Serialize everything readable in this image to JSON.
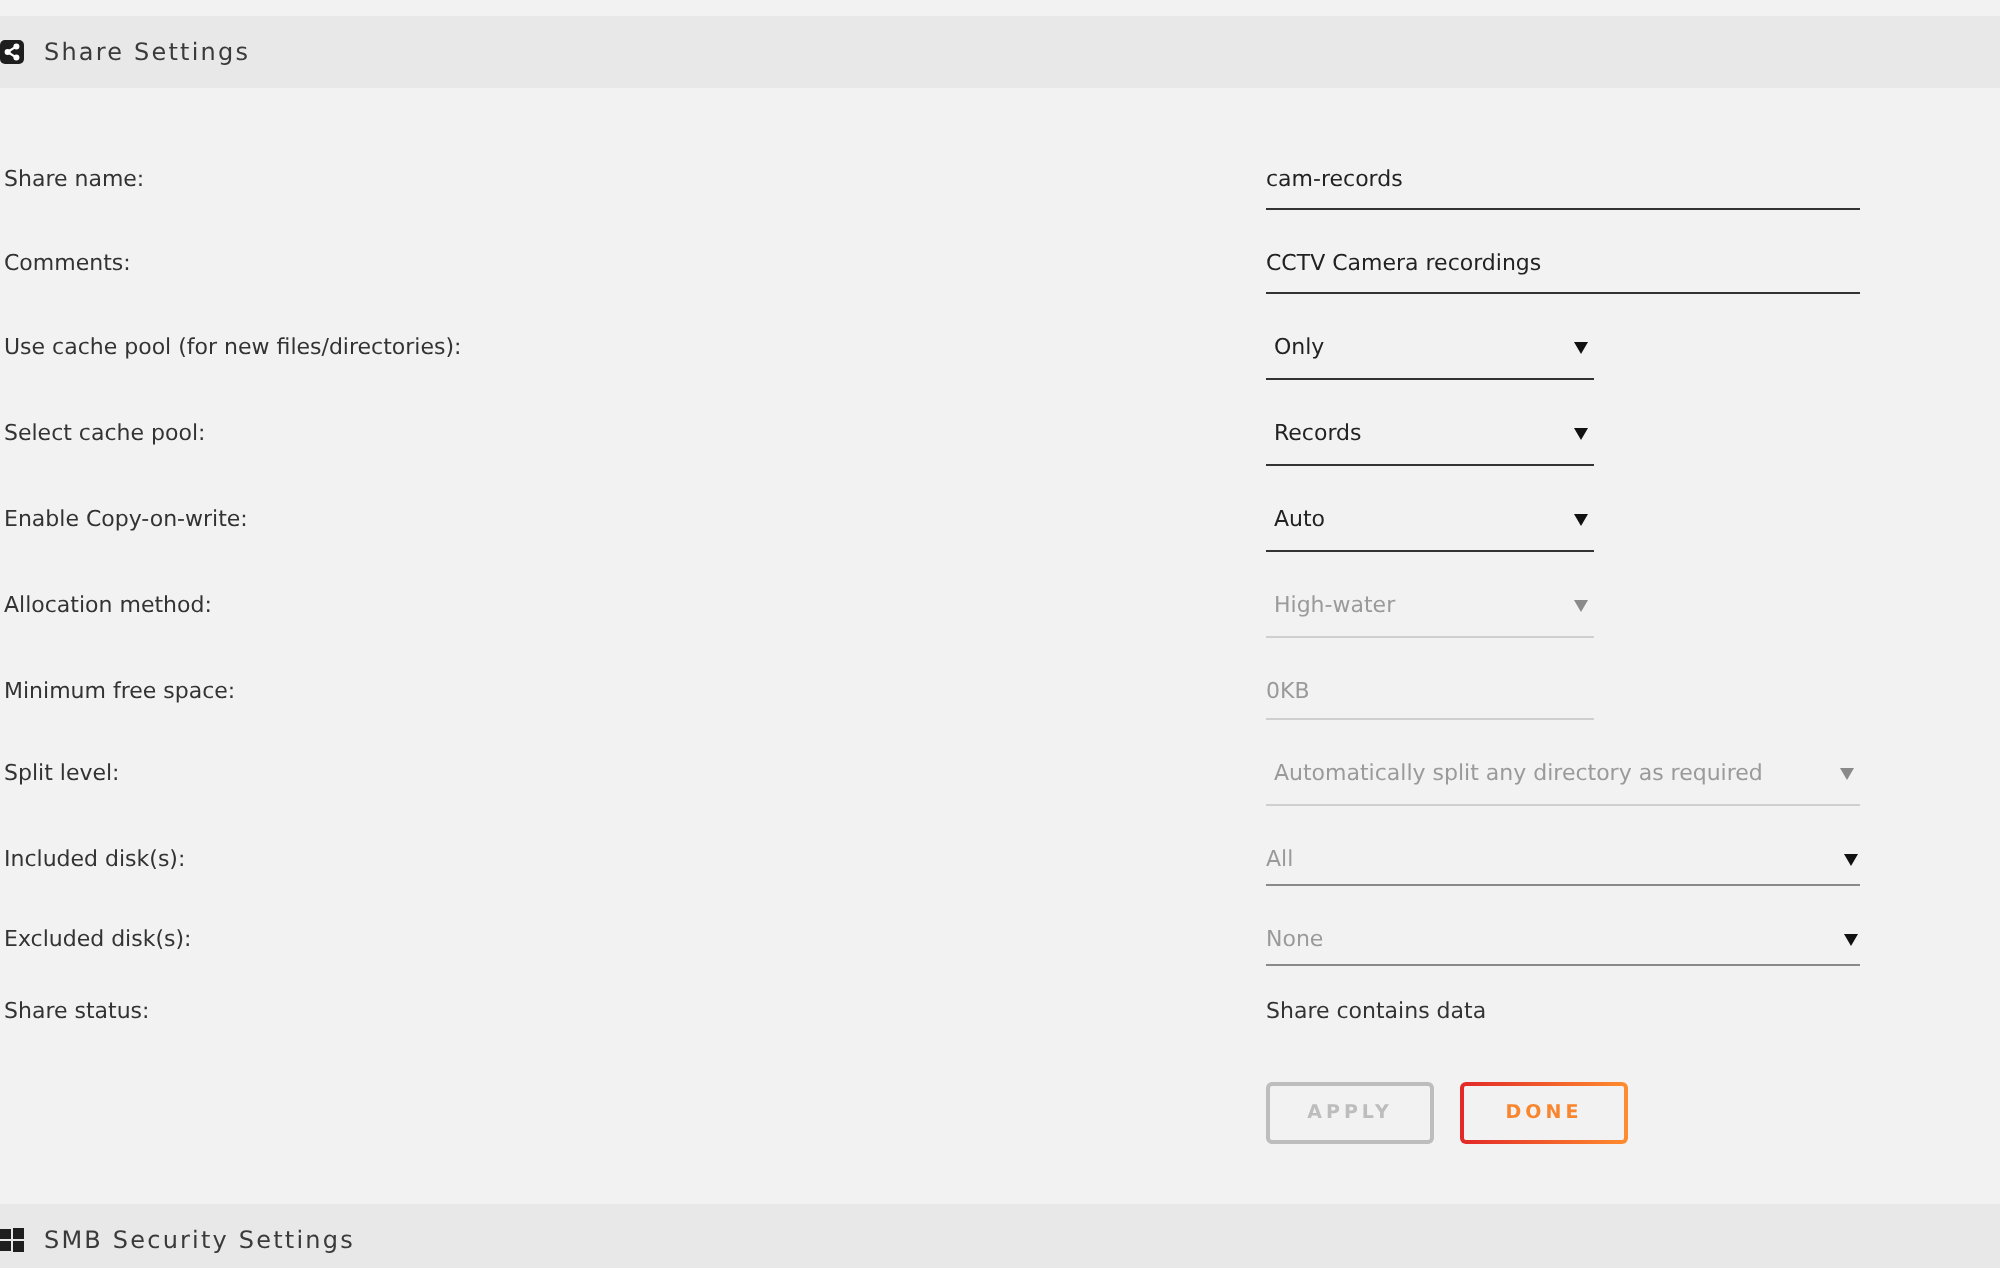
{
  "share_settings": {
    "title": "Share Settings",
    "fields": [
      {
        "label": "Share name:",
        "kind": "text",
        "value": "cam-records",
        "disabled": false
      },
      {
        "label": "Comments:",
        "kind": "text",
        "value": "CCTV Camera recordings",
        "disabled": false
      },
      {
        "label": "Use cache pool (for new files/directories):",
        "kind": "select",
        "value": "Only",
        "disabled": false
      },
      {
        "label": "Select cache pool:",
        "kind": "select",
        "value": "Records",
        "disabled": false
      },
      {
        "label": "Enable Copy-on-write:",
        "kind": "select",
        "value": "Auto",
        "disabled": false
      },
      {
        "label": "Allocation method:",
        "kind": "select",
        "value": "High-water",
        "disabled": true
      },
      {
        "label": "Minimum free space:",
        "kind": "sizeinput",
        "value": "0KB",
        "disabled": true
      },
      {
        "label": "Split level:",
        "kind": "longselect",
        "value": "Automatically split any directory as required",
        "disabled": true
      },
      {
        "label": "Included disk(s):",
        "kind": "disklist",
        "value": "All",
        "disabled": false
      },
      {
        "label": "Excluded disk(s):",
        "kind": "disklist",
        "value": "None",
        "disabled": false
      },
      {
        "label": "Share status:",
        "kind": "status",
        "value": "Share contains data",
        "disabled": false
      }
    ],
    "buttons": [
      {
        "label": "APPLY",
        "disabled": true
      },
      {
        "label": "DONE",
        "disabled": false
      }
    ]
  },
  "smb_security_settings": {
    "title": "SMB Security Settings"
  }
}
